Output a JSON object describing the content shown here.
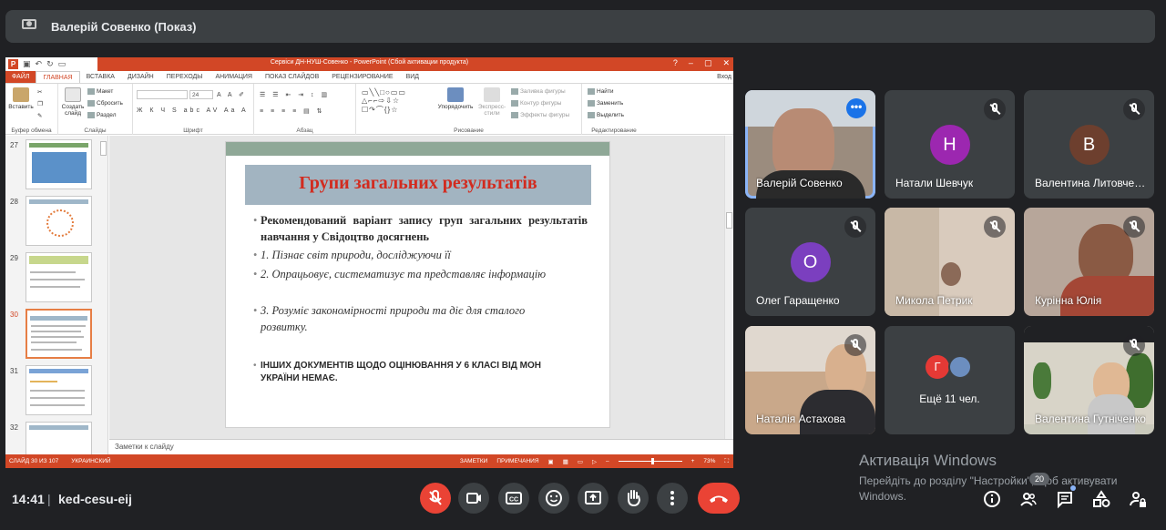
{
  "presenter": {
    "title": "Валерій Совенко (Показ)"
  },
  "ppt": {
    "window_title": "Сервіси ДН-НУШ-Совенко - PowerPoint (Сбой активации продукта)",
    "window_buttons": [
      "?",
      "–",
      "▢",
      "✕"
    ],
    "sign_in": "Вход",
    "tabs": [
      "ФАЙЛ",
      "ГЛАВНАЯ",
      "ВСТАВКА",
      "ДИЗАЙН",
      "ПЕРЕХОДЫ",
      "АНИМАЦИЯ",
      "ПОКАЗ СЛАЙДОВ",
      "РЕЦЕНЗИРОВАНИЕ",
      "ВИД"
    ],
    "ribbon": {
      "paste": "Вставить",
      "clipboard_group": "Буфер обмена",
      "new_slide": "Создать слайд",
      "layout": "Макет",
      "reset": "Сбросить",
      "section": "Раздел",
      "slides_group": "Слайды",
      "font_size": "24",
      "font_group": "Шрифт",
      "paragraph_group": "Абзац",
      "arrange": "Упорядочить",
      "quick_styles": "Экспресс-стили",
      "shape_fill": "Заливка фигуры",
      "shape_outline": "Контур фигуры",
      "shape_effects": "Эффекты фигуры",
      "drawing_group": "Рисование",
      "find": "Найти",
      "replace": "Заменить",
      "select": "Выделить",
      "editing_group": "Редактирование"
    },
    "thumb_numbers": [
      "27",
      "28",
      "29",
      "30",
      "31",
      "32"
    ],
    "notes_placeholder": "Заметки к слайду",
    "status": {
      "slide_of": "СЛАЙД 30 ИЗ 107",
      "language": "УКРАИНСКИЙ",
      "notes": "ЗАМЕТКИ",
      "comments": "ПРИМЕЧАНИЯ",
      "zoom": "73%"
    }
  },
  "slide": {
    "title": "Групи загальних результатів",
    "bullet1": "Рекомендований варіант запису груп загальних результатів навчання у Свідоцтво досягнень",
    "item1": "1. Пізнає світ природи, досліджуючи її",
    "item2": "2. Опрацьовує, систематизує та представляє інформацію",
    "item3": "3. Розуміє закономірності природи та діє для сталого розвитку.",
    "note": "ІНШИХ ДОКУМЕНТІВ ЩОДО ОЦІНЮВАННЯ У 6 КЛАСІ ВІД МОН УКРАЇНИ НЕМАЄ."
  },
  "participants": [
    {
      "name": "Валерій Совенко"
    },
    {
      "name": "Натали Шевчук",
      "initial": "Н",
      "color": "#9c27b0"
    },
    {
      "name": "Валентина Литовченко",
      "initial": "В",
      "color": "#6d3f2e"
    },
    {
      "name": "Олег Гаращенко",
      "initial": "О",
      "color": "#7b3fbf"
    },
    {
      "name": "Микола Петрик"
    },
    {
      "name": "Курінна Юлія"
    },
    {
      "name": "Наталія Астахова"
    },
    {
      "name": "Ещё 11 чел.",
      "initial": "Г",
      "color": "#e53935"
    },
    {
      "name": "Валентина Гутніченко"
    }
  ],
  "windows_activation": {
    "title": "Активація Windows",
    "message": "Перейдіть до розділу \"Настройки\", щоб активувати Windows."
  },
  "bottom": {
    "time": "14:41",
    "meeting_code": "ked-cesu-eij",
    "participants_count": "20"
  },
  "colors": {
    "background": "#202124",
    "tile": "#3c4043",
    "end_call": "#ea4335",
    "ppt_accent": "#d24726",
    "active_speaker": "#8ab4f8"
  }
}
